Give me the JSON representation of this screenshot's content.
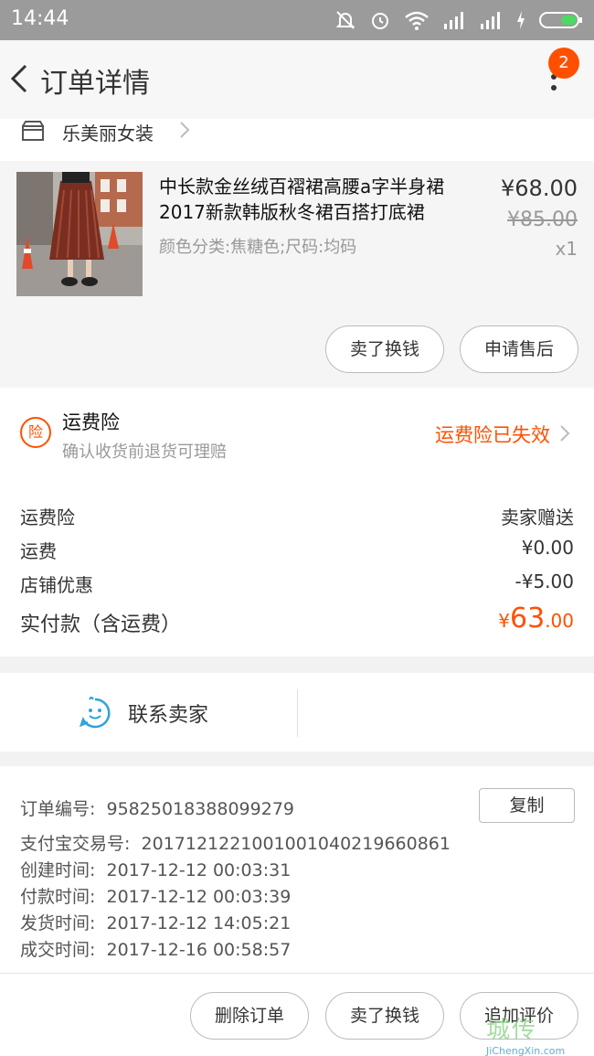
{
  "status_bar": {
    "time": "14:44"
  },
  "nav": {
    "title": "订单详情",
    "badge_count": "2"
  },
  "shop": {
    "name": "乐美丽女装"
  },
  "product": {
    "name": "中长款金丝绒百褶裙高腰a字半身裙2017新款韩版秋冬裙百搭打底裙",
    "sku": "颜色分类:焦糖色;尺码:均码",
    "price": "¥68.00",
    "original_price": "¥85.00",
    "quantity": "x1",
    "buttons": {
      "sell": "卖了换钱",
      "after_sale": "申请售后"
    }
  },
  "insurance": {
    "icon_text": "险",
    "title": "运费险",
    "subtitle": "确认收货前退货可理赔",
    "status": "运费险已失效"
  },
  "fees": {
    "rows": [
      {
        "label": "运费险",
        "value": "卖家赠送"
      },
      {
        "label": "运费",
        "value": "¥0.00"
      },
      {
        "label": "店铺优惠",
        "value": "-¥5.00"
      }
    ],
    "total_label": "实付款（含运费）",
    "total_symbol": "¥",
    "total_integer": "63",
    "total_decimal": ".00"
  },
  "contact": {
    "label": "联系卖家"
  },
  "order_info": {
    "order_no_label": "订单编号:",
    "order_no": "95825018388099279",
    "copy_label": "复制",
    "alipay_label": "支付宝交易号:",
    "alipay_no": "2017121221001001040219660861",
    "created_label": "创建时间:",
    "created": "2017-12-12 00:03:31",
    "paid_label": "付款时间:",
    "paid": "2017-12-12 00:03:39",
    "shipped_label": "发货时间:",
    "shipped": "2017-12-12 14:05:21",
    "done_label": "成交时间:",
    "done": "2017-12-16 00:58:57"
  },
  "bottom_buttons": {
    "delete": "删除订单",
    "sell": "卖了换钱",
    "review": "追加评价"
  },
  "watermark": {
    "top": "城传",
    "bottom": "JiChengXin.com"
  },
  "colors": {
    "accent": "#ff5000",
    "statusbar": "#9b9b9b",
    "contact_icon": "#2aa3e0"
  }
}
